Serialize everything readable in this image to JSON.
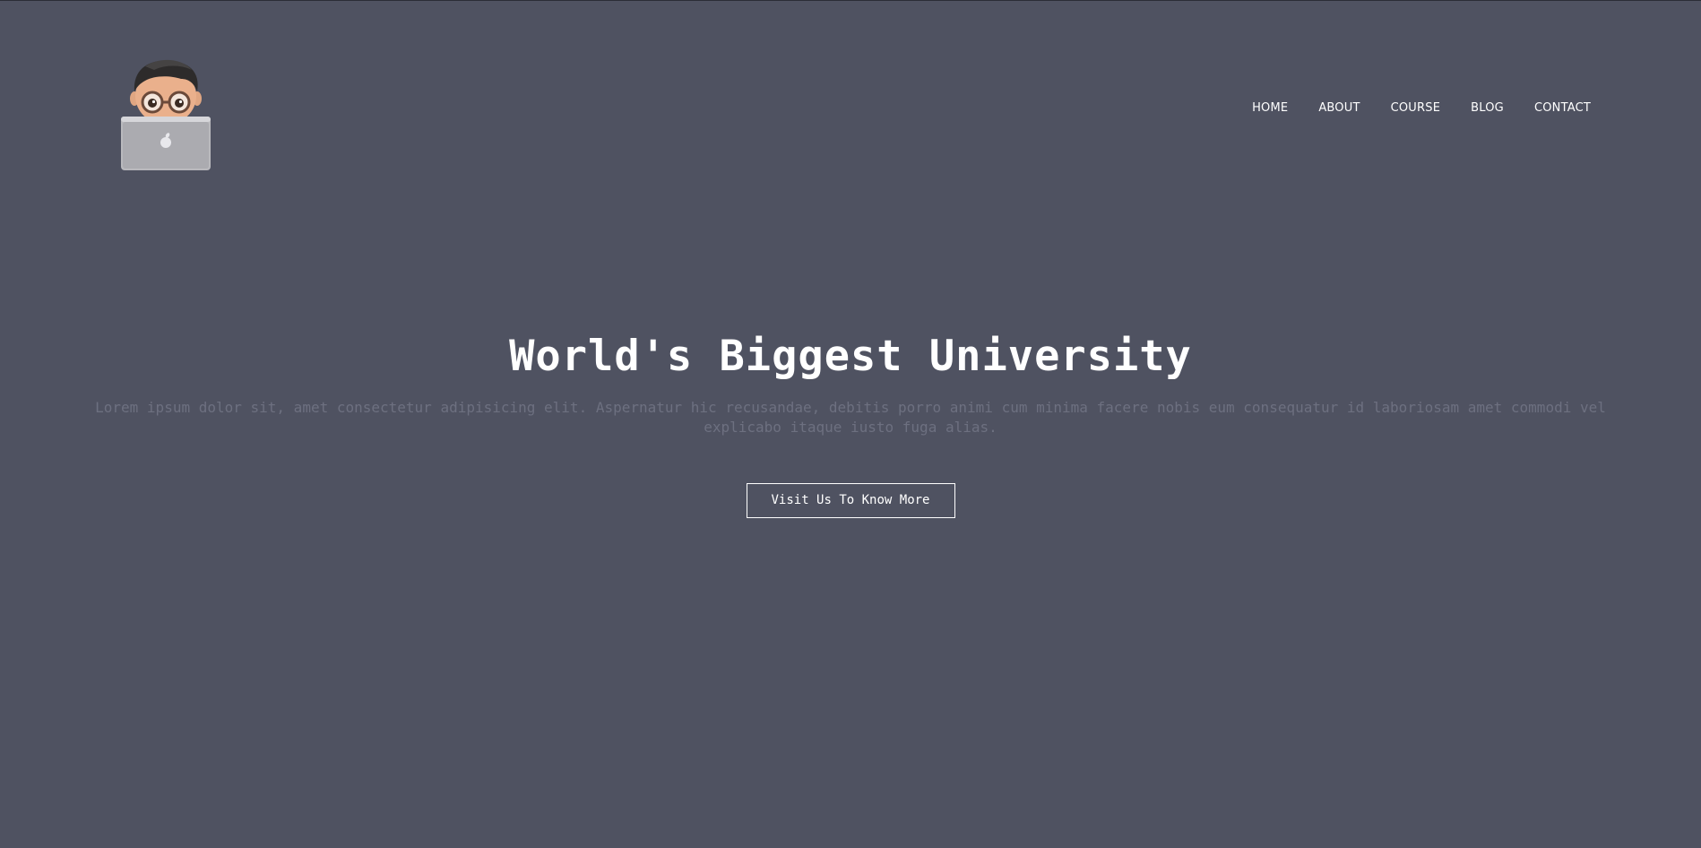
{
  "header": {
    "logo_alt": "memoji-with-laptop-logo"
  },
  "nav": {
    "items": [
      {
        "label": "HOME"
      },
      {
        "label": "ABOUT"
      },
      {
        "label": "COURSE"
      },
      {
        "label": "BLOG"
      },
      {
        "label": "CONTACT"
      }
    ]
  },
  "hero": {
    "title": "World's Biggest University",
    "description": "Lorem ipsum dolor sit, amet consectetur adipisicing elit. Aspernatur hic recusandae, debitis porro animi cum minima facere nobis eum consequatur id laboriosam amet commodi vel explicabo itaque iusto fuga alias.",
    "cta_label": "Visit Us To Know More"
  },
  "colors": {
    "background": "#4f5261",
    "text": "#ffffff",
    "muted_text": "#6d7080"
  }
}
